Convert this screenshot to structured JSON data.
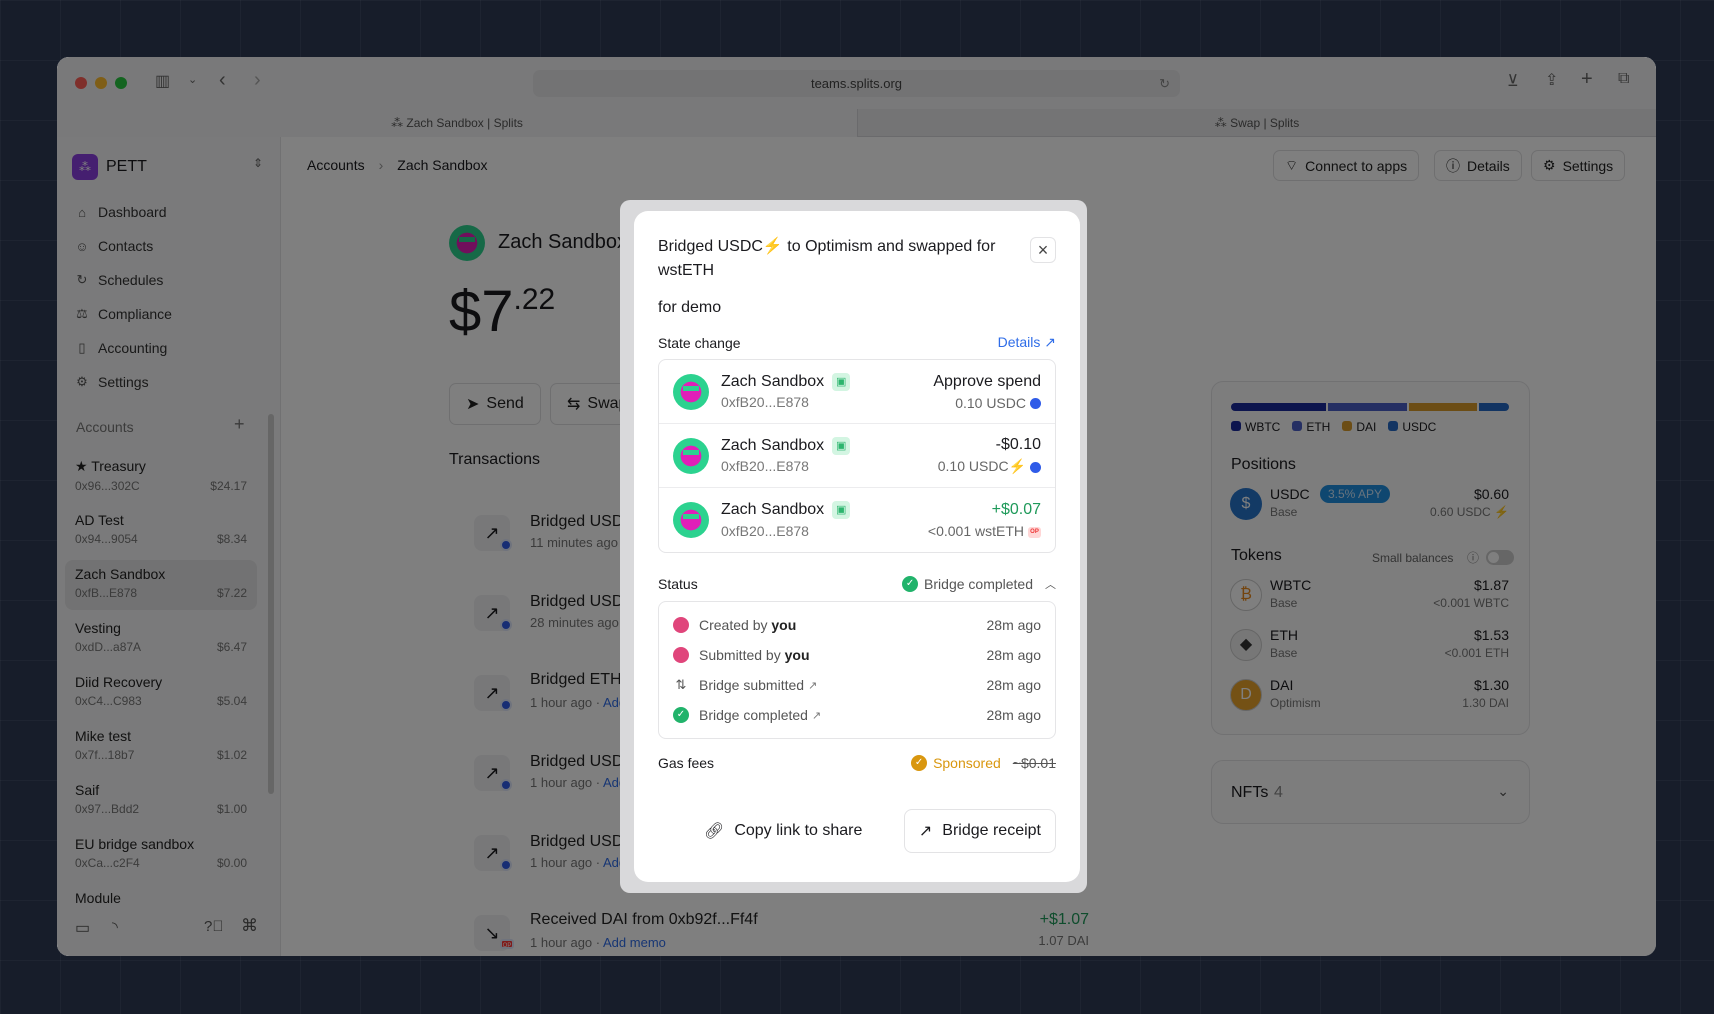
{
  "browser": {
    "url": "teams.splits.org",
    "tabs": [
      "Zach Sandbox | Splits",
      "Swap | Splits"
    ]
  },
  "sidebar": {
    "org": "PETT",
    "nav": [
      "Dashboard",
      "Contacts",
      "Schedules",
      "Compliance",
      "Accounting",
      "Settings"
    ],
    "accounts_label": "Accounts",
    "accounts": [
      {
        "name": "Treasury",
        "address": "0x96...302C",
        "balance": "$24.17",
        "starred": true
      },
      {
        "name": "AD Test",
        "address": "0x94...9054",
        "balance": "$8.34"
      },
      {
        "name": "Zach Sandbox",
        "address": "0xfB...E878",
        "balance": "$7.22",
        "selected": true
      },
      {
        "name": "Vesting",
        "address": "0xdD...a87A",
        "balance": "$6.47"
      },
      {
        "name": "Diid Recovery",
        "address": "0xC4...C983",
        "balance": "$5.04"
      },
      {
        "name": "Mike test",
        "address": "0x7f...18b7",
        "balance": "$1.02"
      },
      {
        "name": "Saif",
        "address": "0x97...Bdd2",
        "balance": "$1.00"
      },
      {
        "name": "EU bridge sandbox",
        "address": "0xCa...c2F4",
        "balance": "$0.00"
      },
      {
        "name": "Module",
        "address": "",
        "balance": ""
      }
    ]
  },
  "header": {
    "breadcrumb": [
      "Accounts",
      "Zach Sandbox"
    ],
    "connect": "Connect to apps",
    "details": "Details",
    "settings": "Settings"
  },
  "account": {
    "name": "Zach Sandbox",
    "balance_whole": "$7",
    "balance_cents": ".22",
    "send": "Send",
    "swap": "Swap"
  },
  "transactions": {
    "title": "Transactions",
    "items": [
      {
        "title": "Bridged USDC⚡",
        "time": "11 minutes ago",
        "memo": "Add memo",
        "dir": "out",
        "chain": "base"
      },
      {
        "title": "Bridged USDC⚡",
        "time": "28 minutes ago",
        "memo": "for demo",
        "dir": "out",
        "chain": "base"
      },
      {
        "title": "Bridged ETH to C",
        "time": "1 hour ago",
        "memo": "Add memo",
        "dir": "out",
        "chain": "base"
      },
      {
        "title": "Bridged USDC⚡",
        "time": "1 hour ago",
        "memo": "Add memo",
        "dir": "out",
        "chain": "base"
      },
      {
        "title": "Bridged USDC⚡",
        "time": "1 hour ago",
        "memo": "Add memo",
        "dir": "out",
        "chain": "base"
      },
      {
        "title": "Received DAI from 0xb92f...Ff4f",
        "time": "1 hour ago",
        "memo": "Add memo",
        "dir": "in",
        "chain": "optimism",
        "amount": "+$1.07",
        "qty": "1.07 DAI"
      }
    ]
  },
  "portfolio": {
    "allocation": [
      {
        "name": "WBTC",
        "pct": 35,
        "color": "#1a2a9c"
      },
      {
        "name": "ETH",
        "pct": 29,
        "color": "#4a5fc6"
      },
      {
        "name": "DAI",
        "pct": 25,
        "color": "#d99a2b"
      },
      {
        "name": "USDC",
        "pct": 11,
        "color": "#2569c4"
      }
    ],
    "positions_title": "Positions",
    "positions": [
      {
        "name": "USDC",
        "chain": "Base",
        "apy": "3.5% APY",
        "value": "$0.60",
        "qty": "0.60 USDC ⚡"
      }
    ],
    "tokens_title": "Tokens",
    "small_balances": "Small balances",
    "small_balances_on": false,
    "tokens": [
      {
        "name": "WBTC",
        "chain": "Base",
        "value": "$1.87",
        "qty": "<0.001 WBTC"
      },
      {
        "name": "ETH",
        "chain": "Base",
        "value": "$1.53",
        "qty": "<0.001 ETH"
      },
      {
        "name": "DAI",
        "chain": "Optimism",
        "value": "$1.30",
        "qty": "1.30 DAI"
      }
    ],
    "nfts_label": "NFTs",
    "nfts_count": "4"
  },
  "modal": {
    "title": "Bridged USDC⚡ to Optimism and swapped for wstETH",
    "memo": "for demo",
    "state_change_label": "State change",
    "details_link": "Details",
    "state_changes": [
      {
        "name": "Zach Sandbox",
        "address": "0xfB20...E878",
        "primary": "Approve spend",
        "secondary": "0.10 USDC",
        "chain": "base",
        "positive": false
      },
      {
        "name": "Zach Sandbox",
        "address": "0xfB20...E878",
        "primary": "-$0.10",
        "secondary": "0.10 USDC⚡",
        "chain": "base",
        "positive": false
      },
      {
        "name": "Zach Sandbox",
        "address": "0xfB20...E878",
        "primary": "+$0.07",
        "secondary": "<0.001 wstETH",
        "chain": "optimism",
        "positive": true
      }
    ],
    "status_label": "Status",
    "status_value": "Bridge completed",
    "timeline": [
      {
        "text": "Created by",
        "who": "you",
        "time": "28m ago"
      },
      {
        "text": "Submitted by",
        "who": "you",
        "time": "28m ago"
      },
      {
        "text": "Bridge submitted",
        "who": "",
        "time": "28m ago"
      },
      {
        "text": "Bridge completed",
        "who": "",
        "time": "28m ago"
      }
    ],
    "gas_label": "Gas fees",
    "gas_status": "Sponsored",
    "gas_amount": "~$0.01",
    "copy_link": "Copy link to share",
    "receipt": "Bridge receipt"
  },
  "colors": {
    "accent": "#2f6de8",
    "success": "#21b36b",
    "sponsored": "#d9970f"
  }
}
